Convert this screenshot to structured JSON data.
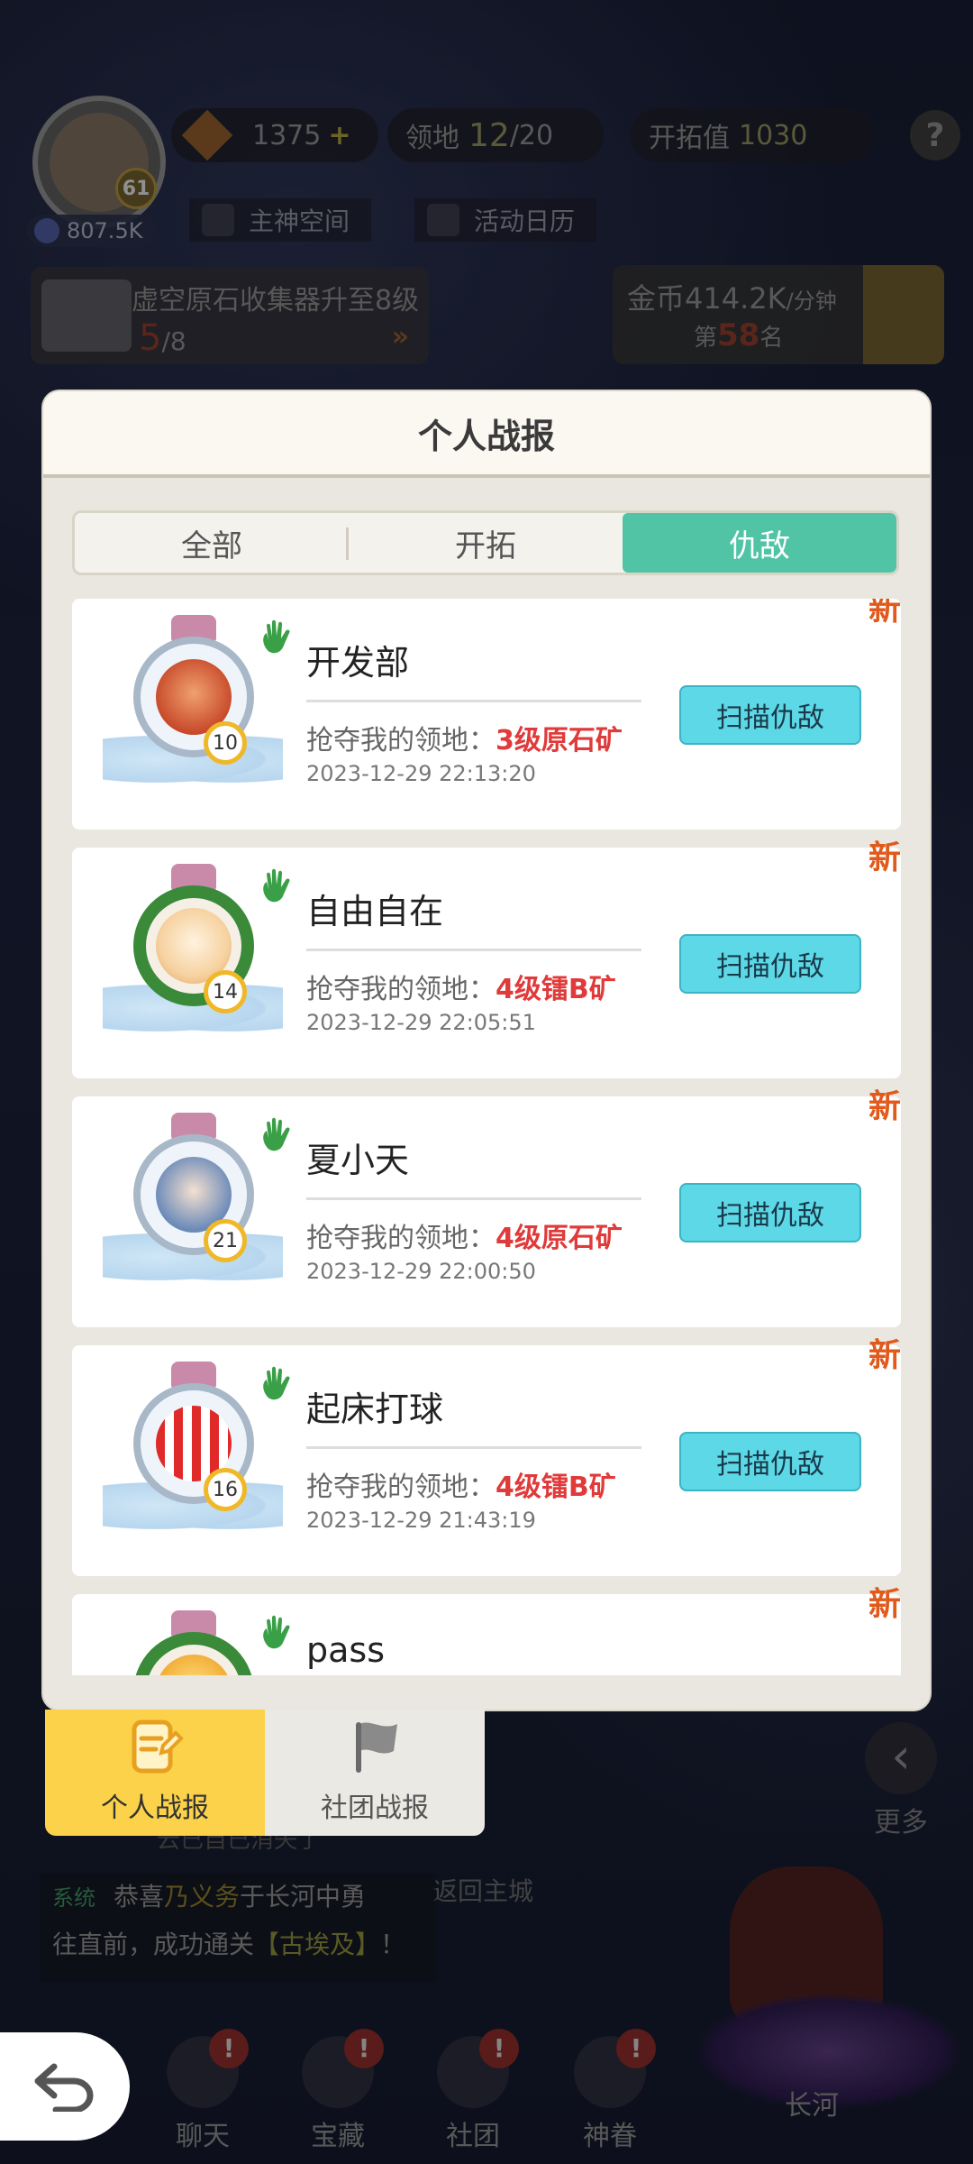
{
  "hud": {
    "player_level": "61",
    "power": "807.5K",
    "diamond": "1375",
    "diamond_plus": "+",
    "land_label": "领地",
    "land_current": "12",
    "land_total": "/20",
    "explore_label": "开拓值",
    "explore_value": "1030",
    "help": "?",
    "god_space": "主神空间",
    "event_calendar": "活动日历",
    "collector_title": "虚空原石收集器升至8级",
    "collector_progress": "5",
    "collector_total": "/8",
    "collector_arrow": "»",
    "gold_label": "金币414.2K",
    "gold_unit": "/分钟",
    "rank_prefix": "第",
    "rank_value": "58",
    "rank_suffix": "名"
  },
  "modal": {
    "title": "个人战报",
    "tabs": [
      {
        "label": "全部"
      },
      {
        "label": "开拓"
      },
      {
        "label": "仇敌"
      }
    ],
    "active_tab": "仇敌",
    "new_badge": "新",
    "desc_prefix": "抢夺我的领地：",
    "scan_label": "扫描仇敌",
    "entries": [
      {
        "name": "开发部",
        "level": "10",
        "target": "3级原石矿",
        "time": "2023-12-29 22:13:20"
      },
      {
        "name": "自由自在",
        "level": "14",
        "target": "4级镭B矿",
        "time": "2023-12-29 22:05:51"
      },
      {
        "name": "夏小天",
        "level": "21",
        "target": "4级原石矿",
        "time": "2023-12-29 22:00:50"
      },
      {
        "name": "起床打球",
        "level": "16",
        "target": "4级镭B矿",
        "time": "2023-12-29 21:43:19"
      },
      {
        "name": "pass",
        "level": "",
        "target": "",
        "time": ""
      }
    ]
  },
  "switch_tabs": {
    "personal": "个人战报",
    "guild": "社团战报"
  },
  "background": {
    "more": "更多",
    "more_icon": "‹",
    "fade_text": "云已自已消失了",
    "return_city": "返回主城",
    "system_tag": "系统",
    "system_msg_1a": "恭喜",
    "system_msg_player": "乃义务",
    "system_msg_1b": "于长河中勇",
    "system_msg_2a": "往直前，成功通关",
    "system_msg_stage": "【古埃及】",
    "system_msg_2b": "！"
  },
  "nav": [
    {
      "label": "聊天",
      "badge": "!"
    },
    {
      "label": "宝藏",
      "badge": "!"
    },
    {
      "label": "社团",
      "badge": "!"
    },
    {
      "label": "神眷",
      "badge": "!"
    },
    {
      "label": "长河",
      "badge": ""
    }
  ],
  "colors": {
    "accent_tab": "#52c4a6",
    "scan_button": "#5cd8e6",
    "target_red": "#e03a3a",
    "new_orange": "#e05a1c",
    "personal_tab_yellow": "#fcd24a"
  }
}
